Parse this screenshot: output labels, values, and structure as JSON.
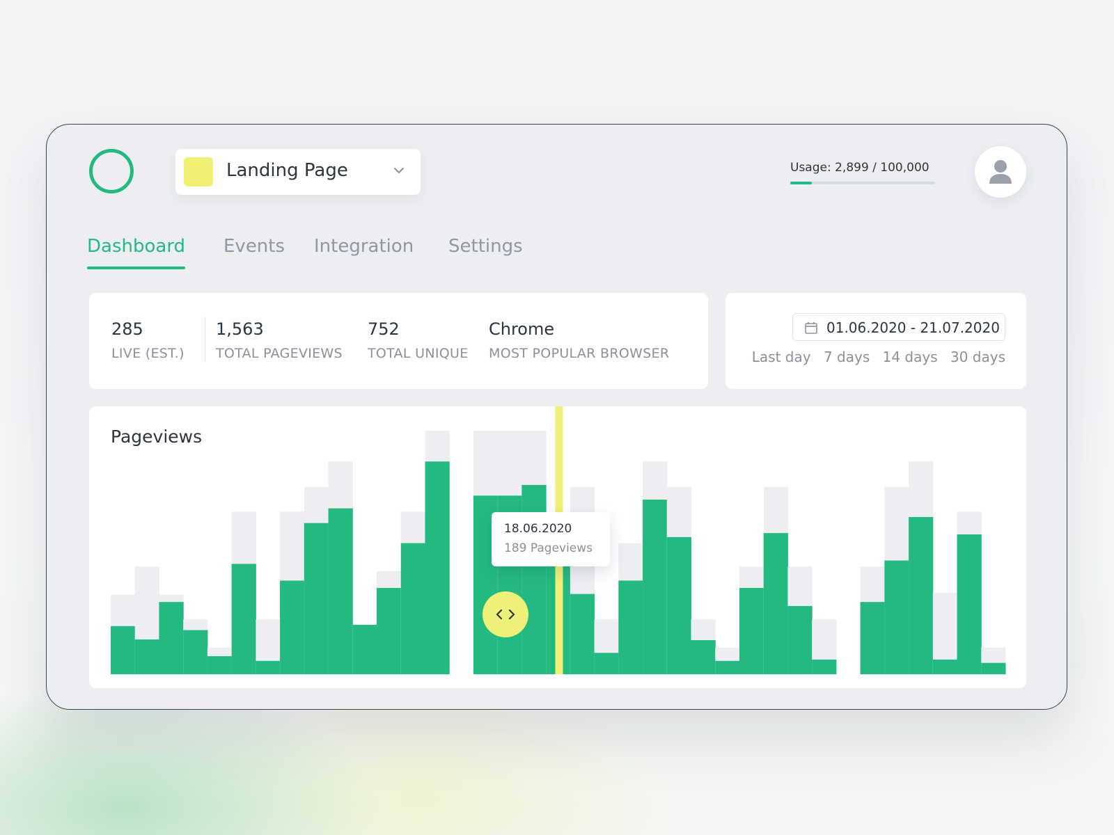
{
  "project": {
    "name": "Landing Page",
    "swatch_color": "#eff074"
  },
  "usage": {
    "label": "Usage: 2,899 / 100,000",
    "used": 2899,
    "limit": 100000
  },
  "tabs": [
    {
      "label": "Dashboard",
      "active": true
    },
    {
      "label": "Events",
      "active": false
    },
    {
      "label": "Integration",
      "active": false
    },
    {
      "label": "Settings",
      "active": false
    }
  ],
  "stats": [
    {
      "value": "285",
      "label": "LIVE (EST.)"
    },
    {
      "value": "1,563",
      "label": "TOTAL PAGEVIEWS"
    },
    {
      "value": "752",
      "label": "TOTAL UNIQUE"
    },
    {
      "value": "Chrome",
      "label": "MOST POPULAR BROWSER"
    }
  ],
  "date_range": {
    "value": "01.06.2020 - 21.07.2020",
    "presets": [
      "Last day",
      "7 days",
      "14 days",
      "30 days"
    ]
  },
  "colors": {
    "accent": "#24b980",
    "highlight": "#eef177",
    "ghost_bar": "#eceef2"
  },
  "icons": [
    "logo-ring-icon",
    "chevron-down-icon",
    "user-icon",
    "calendar-icon",
    "drag-handle-icon"
  ],
  "chart": {
    "title": "Pageviews"
  },
  "tooltip": {
    "date": "18.06.2020",
    "text": "189 Pageviews"
  },
  "chart_data": {
    "type": "bar",
    "title": "Pageviews",
    "selected_bar_index": 18,
    "series": [
      {
        "values": [
          72,
          52,
          108,
          66,
          27,
          165,
          20,
          140,
          226,
          248,
          74,
          129,
          196,
          318,
          0,
          267,
          267,
          283,
          189,
          120,
          32,
          140,
          261,
          205,
          51,
          20,
          129,
          211,
          102,
          22,
          0,
          108,
          170,
          235,
          22,
          209,
          17
        ]
      },
      {
        "values": [
          119,
          161,
          119,
          82,
          40,
          243,
          82,
          243,
          280,
          318,
          74,
          154,
          243,
          364,
          0,
          364,
          364,
          364,
          189,
          280,
          82,
          196,
          318,
          280,
          82,
          40,
          161,
          280,
          161,
          82,
          0,
          161,
          280,
          318,
          122,
          243,
          40
        ]
      }
    ]
  }
}
